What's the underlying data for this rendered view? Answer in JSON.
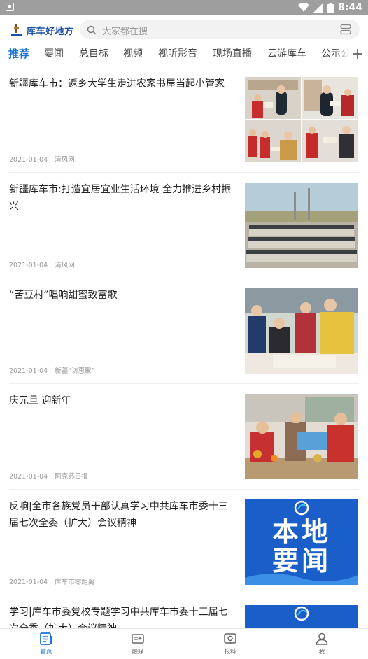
{
  "status_bar": {
    "time": "8:44"
  },
  "header": {
    "logo_text": "库车好地方",
    "search_placeholder": "大家都在搜"
  },
  "tabs": [
    {
      "label": "推荐",
      "active": true
    },
    {
      "label": "要闻"
    },
    {
      "label": "总目标"
    },
    {
      "label": "视频"
    },
    {
      "label": "视听影音"
    },
    {
      "label": "现场直播"
    },
    {
      "label": "云游库车"
    },
    {
      "label": "公示公"
    }
  ],
  "feed": [
    {
      "title": "新疆库车市：返乡大学生走进农家书屋当起小管家",
      "date": "2021-01-04",
      "source": "清风网"
    },
    {
      "title": "新疆库车市:打造宜居宜业生活环境 全力推进乡村振兴",
      "date": "2021-01-04",
      "source": "清风网"
    },
    {
      "title": "“苦豆村”唱响甜蜜致富歌",
      "date": "2021-01-04",
      "source": "新疆“访惠聚”"
    },
    {
      "title": "庆元旦 迎新年",
      "date": "2021-01-04",
      "source": "阿克苏日报"
    },
    {
      "title": "反响|全市各族党员干部认真学习中共库车市委十三届七次全委（扩大）会议精神",
      "date": "2021-01-04",
      "source": "库车市零距离",
      "thumb_line1": "本地",
      "thumb_line2": "要闻"
    },
    {
      "title": "学习|库车市委党校专题学习中共库车市委十三届七次全委（扩大）会议精神",
      "date": "",
      "source": ""
    }
  ],
  "bottom_nav": [
    {
      "label": "首页",
      "icon": "home-news-icon",
      "active": true
    },
    {
      "label": "融媒",
      "icon": "media-icon"
    },
    {
      "label": "报料",
      "icon": "report-icon"
    },
    {
      "label": "我",
      "icon": "user-icon"
    }
  ],
  "colors": {
    "accent": "#1a73d9",
    "status_bar": "#9e9e9e",
    "logo": "#1a4fa3"
  }
}
